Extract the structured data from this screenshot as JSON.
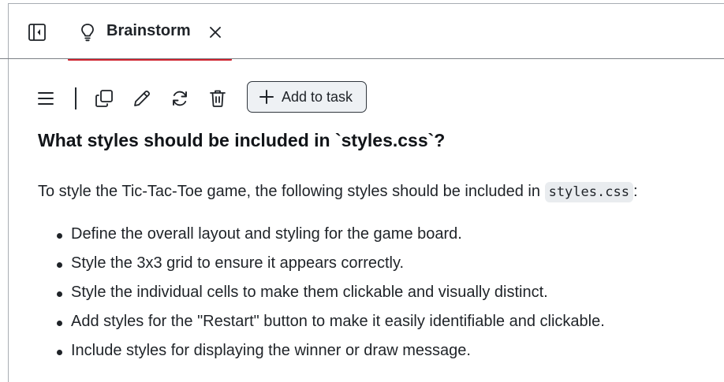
{
  "tab": {
    "icon": "lightbulb-icon",
    "label": "Brainstorm",
    "close_icon": "close-icon",
    "active_color": "#cf222e"
  },
  "toolbar": {
    "buttons": [
      {
        "name": "menu-icon"
      },
      {
        "name": "copy-icon"
      },
      {
        "name": "edit-icon"
      },
      {
        "name": "refresh-icon"
      },
      {
        "name": "trash-icon"
      }
    ],
    "add_task_label": "Add to task"
  },
  "content": {
    "heading": "What styles should be included in `styles.css`?",
    "intro_text": "To style the Tic-Tac-Toe game, the following styles should be included in",
    "intro_code": "styles.css",
    "intro_suffix": ":",
    "bullets": [
      "Define the overall layout and styling for the game board.",
      "Style the 3x3 grid to ensure it appears correctly.",
      "Style the individual cells to make them clickable and visually distinct.",
      "Add styles for the \"Restart\" button to make it easily identifiable and clickable.",
      "Include styles for displaying the winner or draw message."
    ]
  }
}
